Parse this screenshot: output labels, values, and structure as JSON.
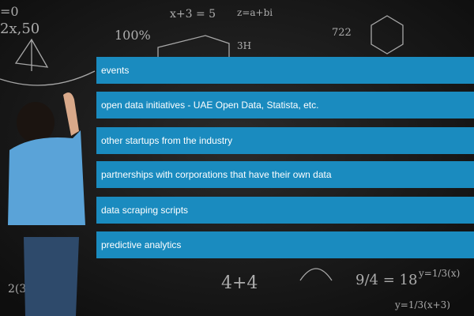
{
  "slide": {
    "accent_color": "#1a8bbf",
    "background": "chalkboard-with-math-and-child",
    "items": [
      {
        "label": "events"
      },
      {
        "label": "open data initiatives - UAE Open Data, Statista, etc."
      },
      {
        "label": "other startups from the industry"
      },
      {
        "label": "partnerships with corporations that have their own data"
      },
      {
        "label": "data scraping scripts"
      },
      {
        "label": "predictive analytics"
      }
    ]
  }
}
